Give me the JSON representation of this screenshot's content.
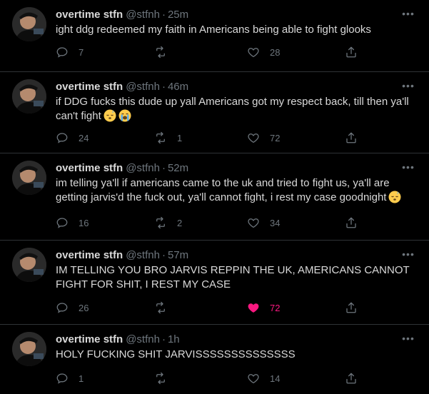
{
  "tweets": [
    {
      "name": "overtime stfn",
      "handle": "@stfnh",
      "dot": "·",
      "time": "25m",
      "text": "ight ddg redeemed my faith in Americans being able to fight glooks",
      "emojis": [],
      "reply_count": "7",
      "retweet_count": "",
      "like_count": "28",
      "liked": false
    },
    {
      "name": "overtime stfn",
      "handle": "@stfnh",
      "dot": "·",
      "time": "46m",
      "text": "if DDG fucks this dude up yall Americans got my respect back, till then ya'll can't fight",
      "emojis": [
        "sleeping-face-emoji",
        "loudly-crying-face-emoji"
      ],
      "reply_count": "24",
      "retweet_count": "1",
      "like_count": "72",
      "liked": false
    },
    {
      "name": "overtime stfn",
      "handle": "@stfnh",
      "dot": "·",
      "time": "52m",
      "text": "im telling ya'll if americans came to the uk and tried to fight us, ya'll are getting jarvis'd the fuck out, ya'll cannot fight, i rest my case goodnight",
      "emojis": [
        "sleeping-face-emoji"
      ],
      "reply_count": "16",
      "retweet_count": "2",
      "like_count": "34",
      "liked": false
    },
    {
      "name": "overtime stfn",
      "handle": "@stfnh",
      "dot": "·",
      "time": "57m",
      "text": "IM TELLING YOU BRO JARVIS REPPIN THE UK, AMERICANS CANNOT FIGHT FOR SHIT, I REST MY CASE",
      "emojis": [],
      "reply_count": "26",
      "retweet_count": "",
      "like_count": "72",
      "liked": true
    },
    {
      "name": "overtime stfn",
      "handle": "@stfnh",
      "dot": "·",
      "time": "1h",
      "text": "HOLY FUCKING SHIT JARVISSSSSSSSSSSSSS",
      "emojis": [],
      "reply_count": "1",
      "retweet_count": "",
      "like_count": "14",
      "liked": false
    }
  ],
  "icons": {
    "reply": "reply-icon",
    "retweet": "retweet-icon",
    "like": "heart-icon",
    "share": "share-icon",
    "more": "more-options-icon"
  },
  "colors": {
    "background": "#000000",
    "text": "#d9d9d9",
    "secondary": "#6e767d",
    "divider": "#2f3336",
    "like_active": "#f91880"
  }
}
